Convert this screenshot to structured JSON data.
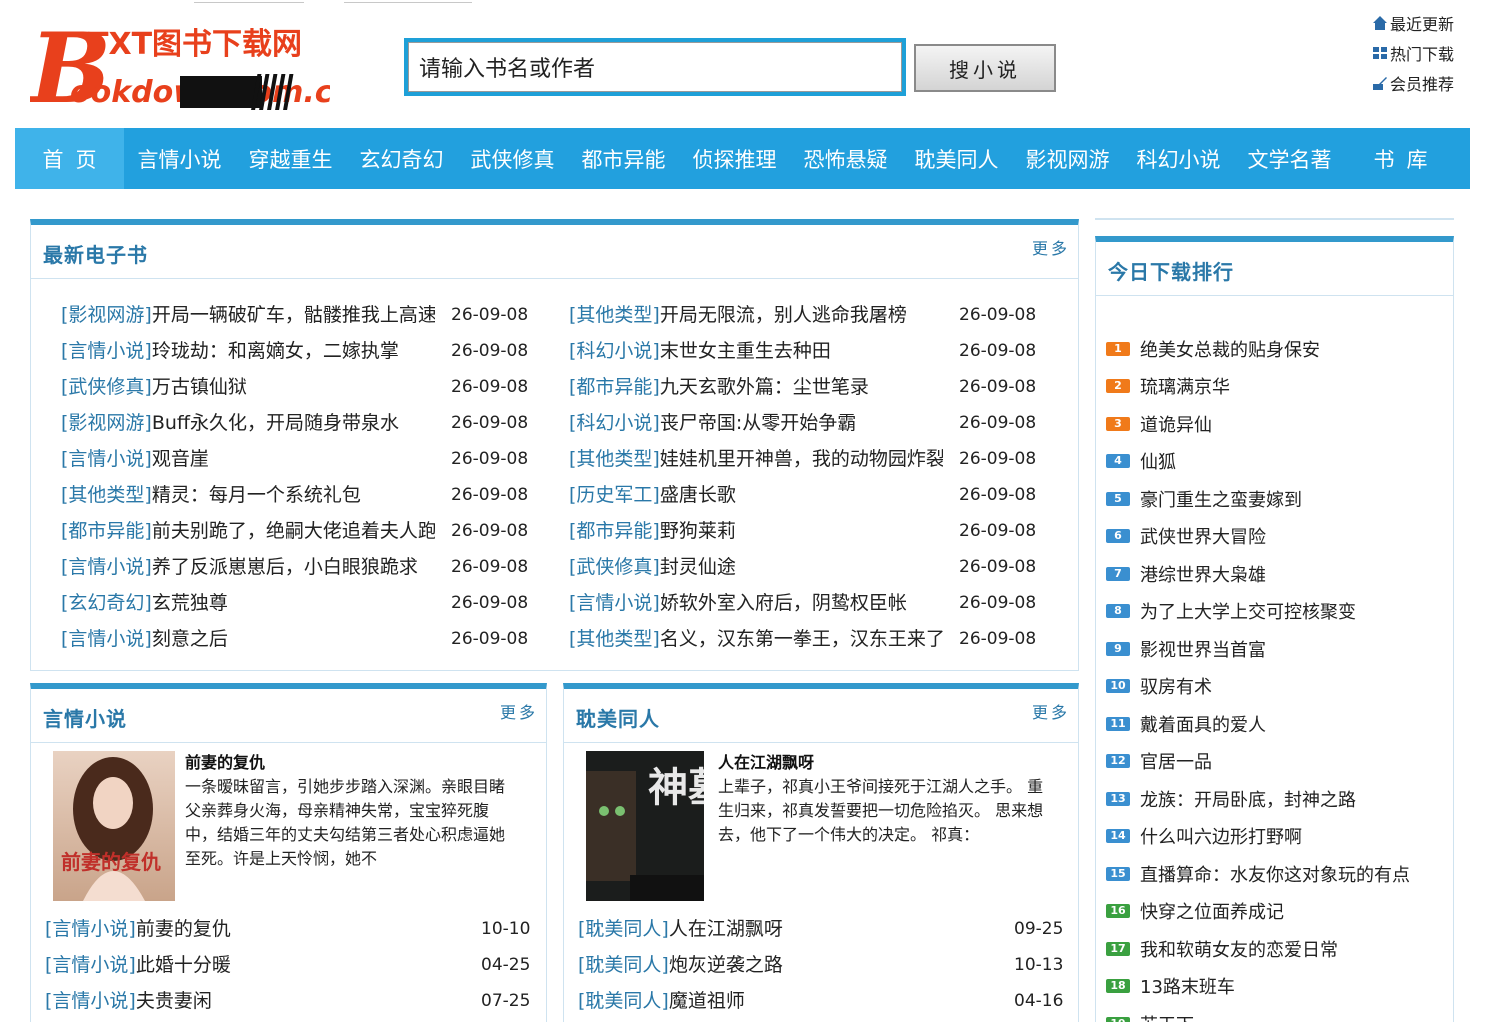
{
  "site": {
    "logo_text_top": "TXT图书下载网",
    "logo_text_bottom": "ookdown.com.cn",
    "logo_letter": "B"
  },
  "search": {
    "placeholder": "请输入书名或作者",
    "button": "搜小说"
  },
  "quick_links": [
    {
      "label": "最近更新",
      "icon": "home-icon"
    },
    {
      "label": "热门下载",
      "icon": "grid-icon"
    },
    {
      "label": "会员推荐",
      "icon": "edit-icon"
    }
  ],
  "nav": [
    "首页",
    "言情小说",
    "穿越重生",
    "玄幻奇幻",
    "武侠修真",
    "都市异能",
    "侦探推理",
    "恐怖悬疑",
    "耽美同人",
    "影视网游",
    "科幻小说",
    "文学名著",
    "书库"
  ],
  "latest": {
    "title": "最新电子书",
    "more": "更多",
    "left": [
      {
        "cat": "[影视网游]",
        "name": "开局一辆破矿车，骷髅推我上高速",
        "date": "26-09-08"
      },
      {
        "cat": "[言情小说]",
        "name": "玲珑劫：和离嫡女，二嫁执掌",
        "date": "26-09-08"
      },
      {
        "cat": "[武侠修真]",
        "name": "万古镇仙狱",
        "date": "26-09-08"
      },
      {
        "cat": "[影视网游]",
        "name": "Buff永久化，开局随身带泉水",
        "date": "26-09-08"
      },
      {
        "cat": "[言情小说]",
        "name": "观音崖",
        "date": "26-09-08"
      },
      {
        "cat": "[其他类型]",
        "name": "精灵：每月一个系统礼包",
        "date": "26-09-08"
      },
      {
        "cat": "[都市异能]",
        "name": "前夫别跪了，绝嗣大佬追着夫人跑",
        "date": "26-09-08"
      },
      {
        "cat": "[言情小说]",
        "name": "养了反派崽崽后，小白眼狼跪求",
        "date": "26-09-08"
      },
      {
        "cat": "[玄幻奇幻]",
        "name": "玄荒独尊",
        "date": "26-09-08"
      },
      {
        "cat": "[言情小说]",
        "name": "刻意之后",
        "date": "26-09-08"
      }
    ],
    "right": [
      {
        "cat": "[其他类型]",
        "name": "开局无限流，别人逃命我屠榜",
        "date": "26-09-08"
      },
      {
        "cat": "[科幻小说]",
        "name": "末世女主重生去种田",
        "date": "26-09-08"
      },
      {
        "cat": "[都市异能]",
        "name": "九天玄歌外篇：尘世笔录",
        "date": "26-09-08"
      },
      {
        "cat": "[科幻小说]",
        "name": "丧尸帝国:从零开始争霸",
        "date": "26-09-08"
      },
      {
        "cat": "[其他类型]",
        "name": "娃娃机里开神兽，我的动物园炸裂了",
        "date": "26-09-08"
      },
      {
        "cat": "[历史军工]",
        "name": "盛唐长歌",
        "date": "26-09-08"
      },
      {
        "cat": "[都市异能]",
        "name": "野狗莱莉",
        "date": "26-09-08"
      },
      {
        "cat": "[武侠修真]",
        "name": "封灵仙途",
        "date": "26-09-08"
      },
      {
        "cat": "[言情小说]",
        "name": "娇软外室入府后，阴鸷权臣帐",
        "date": "26-09-08"
      },
      {
        "cat": "[其他类型]",
        "name": "名义，汉东第一拳王，汉东王来了",
        "date": "26-09-08"
      }
    ]
  },
  "romance": {
    "title": "言情小说",
    "more": "更多",
    "cover_text": "前妻的复仇",
    "feature_title": "前妻的复仇",
    "feature_desc": "一条暧昧留言，引她步步踏入深渊。亲眼目睹父亲葬身火海，母亲精神失常，宝宝猝死腹中，结婚三年的丈夫勾结第三者处心积虑逼她至死。许是上天怜悯，她不",
    "rows": [
      {
        "cat": "[言情小说]",
        "name": "前妻的复仇",
        "date": "10-10"
      },
      {
        "cat": "[言情小说]",
        "name": "此婚十分暖",
        "date": "04-25"
      },
      {
        "cat": "[言情小说]",
        "name": "夫贵妻闲",
        "date": "07-25"
      }
    ]
  },
  "danmei": {
    "title": "耽美同人",
    "more": "更多",
    "cover_text": "神墓",
    "feature_title": "人在江湖飘呀",
    "feature_desc": "上辈子，祁真小王爷间接死于江湖人之手。 重生归来，祁真发誓要把一切危险掐灭。 思来想去，他下了一个伟大的决定。 祁真：",
    "rows": [
      {
        "cat": "[耽美同人]",
        "name": "人在江湖飘呀",
        "date": "09-25"
      },
      {
        "cat": "[耽美同人]",
        "name": "炮灰逆袭之路",
        "date": "10-13"
      },
      {
        "cat": "[耽美同人]",
        "name": "魔道祖师",
        "date": "04-16"
      }
    ]
  },
  "ranking": {
    "title": "今日下载排行",
    "colors": {
      "top3": "#f07a1a",
      "mid": "#3a8fd0",
      "end": "#3aa040"
    },
    "items": [
      "绝美女总裁的贴身保安",
      "琉璃满京华",
      "道诡异仙",
      "仙狐",
      "豪门重生之蛮妻嫁到",
      "武侠世界大冒险",
      "港综世界大枭雄",
      "为了上大学上交可控核聚变",
      "影视世界当首富",
      "驭房有术",
      "戴着面具的爱人",
      "官居一品",
      "龙族：开局卧底，封神之路",
      "什么叫六边形打野啊",
      "直播算命：水友你这对象玩的有点",
      "快穿之位面养成记",
      "我和软萌女友的恋爱日常",
      "13路末班车",
      "苏天下"
    ]
  }
}
